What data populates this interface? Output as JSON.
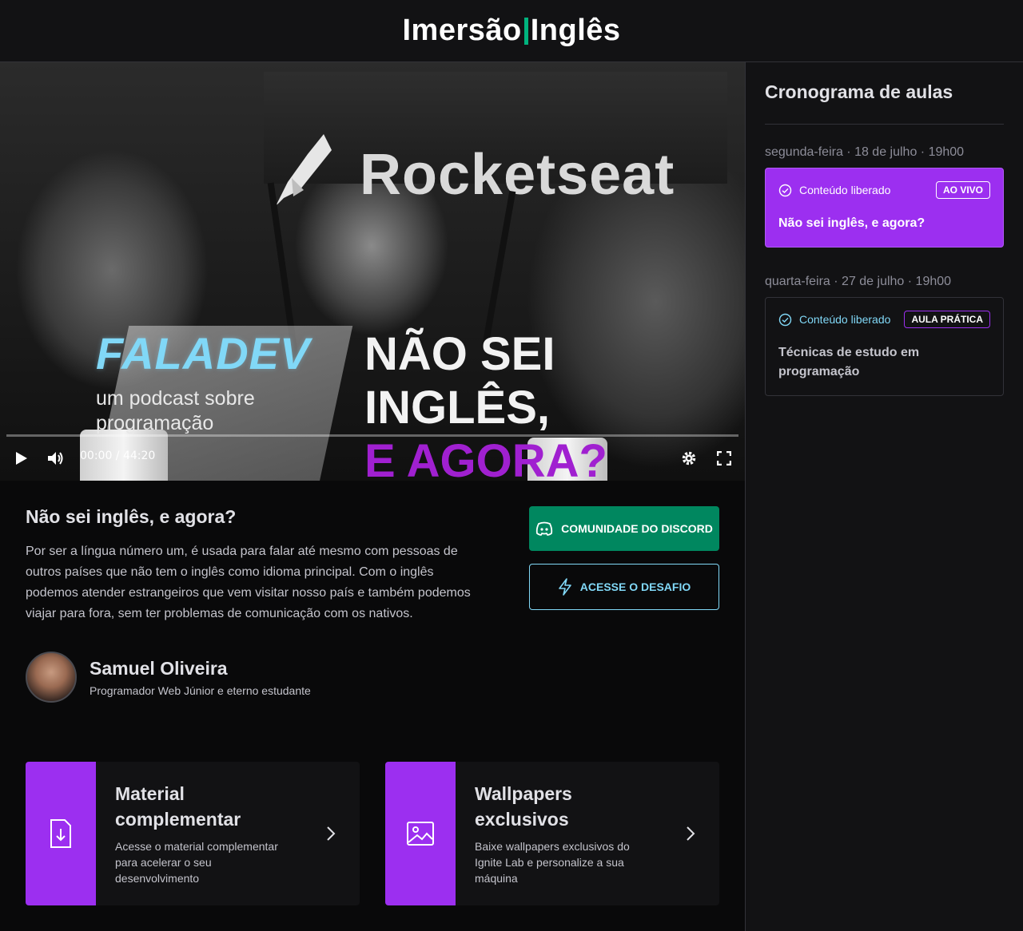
{
  "header": {
    "logo_left": "Imersão",
    "logo_right": "Inglês"
  },
  "video": {
    "overlay_brand": "Rocketseat",
    "podcast_title": "FALADEV",
    "podcast_subtitle": "um podcast sobre programação",
    "headline_line1": "NÃO SEI",
    "headline_line2": "INGLÊS,",
    "headline_line3": "E AGORA?",
    "time_display": "00:00 / 44:20",
    "progress": 0
  },
  "lesson": {
    "title": "Não sei inglês, e agora?",
    "description": "Por ser a língua número um, é usada para falar até mesmo com pessoas de outros países que não tem o inglês como idioma principal. Com o inglês podemos atender estrangeiros que vem visitar nosso país e também podemos viajar para fora, sem ter problemas de comunicação com os nativos.",
    "discord_label": "COMUNIDADE DO DISCORD",
    "challenge_label": "ACESSE O DESAFIO"
  },
  "teacher": {
    "name": "Samuel Oliveira",
    "bio": "Programador Web Júnior e eterno estudante"
  },
  "cards": [
    {
      "title": "Material complementar",
      "description": "Acesse o material complementar para acelerar o seu desenvolvimento",
      "icon": "file-download-icon"
    },
    {
      "title": "Wallpapers exclusivos",
      "description": "Baixe wallpapers exclusivos do Ignite Lab e personalize a sua máquina",
      "icon": "image-icon"
    }
  ],
  "sidebar": {
    "title": "Cronograma de aulas",
    "lessons": [
      {
        "date": "segunda-feira · 18 de julho · 19h00",
        "status": "Conteúdo liberado",
        "badge": "AO VIVO",
        "title": "Não sei inglês, e agora?",
        "active": true
      },
      {
        "date": "quarta-feira · 27 de julho · 19h00",
        "status": "Conteúdo liberado",
        "badge": "AULA PRÁTICA",
        "title": "Técnicas de estudo em programação",
        "active": false
      }
    ]
  },
  "colors": {
    "brand_green": "#00b37e",
    "discord_green": "#00875f",
    "accent_blue": "#81d8f7",
    "accent_purple": "#9c2ff0"
  }
}
